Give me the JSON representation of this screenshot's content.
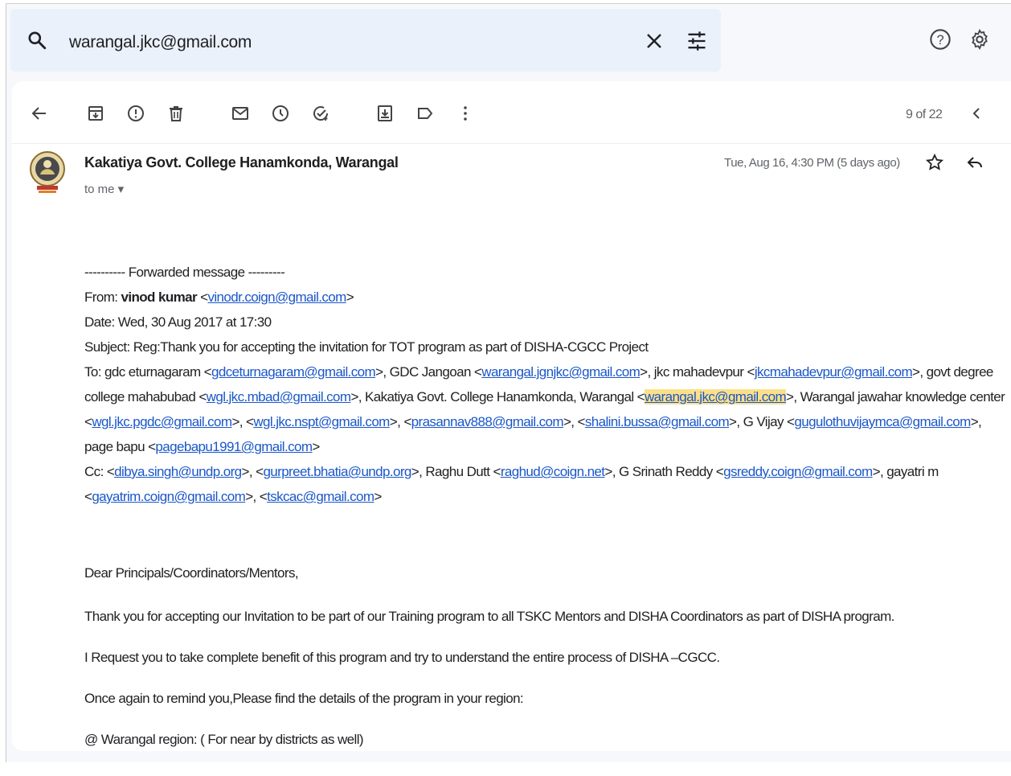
{
  "search": {
    "query": "warangal.jkc@gmail.com"
  },
  "icons": {
    "search": "search-icon",
    "clear": "close-icon",
    "filters": "tune-icon",
    "help": "help-icon",
    "settings": "settings-gear-icon",
    "back": "arrow-back-icon",
    "archive": "archive-icon",
    "spam": "report-spam-icon",
    "delete": "trash-icon",
    "unread": "mail-unread-icon",
    "snooze": "snooze-clock-icon",
    "task": "add-task-icon",
    "move": "move-to-icon",
    "label": "label-icon",
    "more": "more-vert-icon",
    "prev": "chevron-left-icon",
    "next": "chevron-right-icon",
    "star": "star-icon",
    "reply": "reply-icon"
  },
  "pagination": "9 of 22",
  "email": {
    "sender": "Kakatiya Govt. College Hanamkonda, Warangal",
    "to_me": "to me",
    "date": "Tue, Aug 16, 4:30 PM (5 days ago)",
    "fwd": {
      "header": "---------- Forwarded message ---------",
      "from_label": "From: ",
      "from_name": "vinod kumar",
      "from_email": "vinodr.coign@gmail.com",
      "date": "Date: Wed, 30 Aug 2017 at 17:30",
      "subject": "Subject: Reg:Thank you for accepting the invitation for TOT program as part of DISHA-CGCC Project",
      "to_label": "To: gdc eturnagaram <",
      "to1": "gdceturnagaram@gmail.com",
      "to1b": ">, GDC Jangoan <",
      "to2": "warangal.jgnjkc@gmail.com",
      "to2b": ">, jkc mahadevpur <",
      "to3": "jkcmahadevpur@gmail.com",
      "to3b": ">, govt degree",
      "to_l2a": "college mahabubad <",
      "to4": "wgl.jkc.mbad@gmail.com",
      "to4b": ">, Kakatiya Govt. College Hanamkonda, Warangal <",
      "to5": "warangal.jkc@gmail.com",
      "to5b": ">, Warangal jawahar knowledge center",
      "to_l3a": "<",
      "to6": "wgl.jkc.pgdc@gmail.com",
      "to6b": ">, <",
      "to7": "wgl.jkc.nspt@gmail.com",
      "to7b": ">, <",
      "to8": "prasannav888@gmail.com",
      "to8b": ">, <",
      "to9": "shalini.bussa@gmail.com",
      "to9b": ">, G Vijay <",
      "to10": "gugulothuvijaymca@gmail.com",
      "to10b": ">,",
      "to_l4a": "page bapu <",
      "to11": "pagebapu1991@gmail.com",
      "to11b": ">",
      "cc_label": "Cc: <",
      "cc1": "dibya.singh@undp.org",
      "cc1b": ">, <",
      "cc2": "gurpreet.bhatia@undp.org",
      "cc2b": ">, Raghu Dutt <",
      "cc3": "raghud@coign.net",
      "cc3b": ">, G Srinath Reddy <",
      "cc4": "gsreddy.coign@gmail.com",
      "cc4b": ">, gayatri m",
      "cc_l2a": "<",
      "cc5": "gayatrim.coign@gmail.com",
      "cc5b": ">, <",
      "cc6": "tskcac@gmail.com",
      "cc6b": ">"
    },
    "greeting": "Dear Principals/Coordinators/Mentors,",
    "p1": "Thank you for accepting our Invitation to be part of our Training program to all TSKC Mentors and DISHA Coordinators as part of DISHA program.",
    "p2": "I Request you to take complete benefit of this program and try to understand the entire process of DISHA –CGCC.",
    "p3": "Once again to remind you,Please find the details of the program in your region:",
    "p4": "@  Warangal region: ( For near by districts as well)"
  }
}
